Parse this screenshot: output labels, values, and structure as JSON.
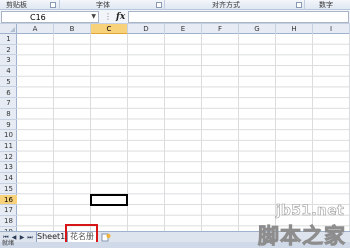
{
  "ribbon": {
    "groups": [
      "剪贴板",
      "字体",
      "对齐方式",
      "数字"
    ]
  },
  "formula_bar": {
    "name_box": "C16",
    "fx_label": "fx",
    "formula": ""
  },
  "sheet": {
    "columns": [
      "A",
      "B",
      "C",
      "D",
      "E",
      "F",
      "G",
      "H",
      "I"
    ],
    "rows": [
      "1",
      "2",
      "3",
      "4",
      "5",
      "6",
      "7",
      "8",
      "9",
      "10",
      "11",
      "12",
      "13",
      "14",
      "15",
      "16",
      "17",
      "18",
      "19"
    ],
    "active_column": "C",
    "active_row": "16"
  },
  "tabs": {
    "sheets": [
      "Sheet1",
      "花名册"
    ],
    "active": "花名册"
  },
  "status": {
    "text": "就绪"
  },
  "watermark": {
    "domain": "jb51.net",
    "brand": "脚本之家"
  },
  "colors": {
    "highlight_box": "#d71717",
    "active_header": "#f8d27a"
  }
}
